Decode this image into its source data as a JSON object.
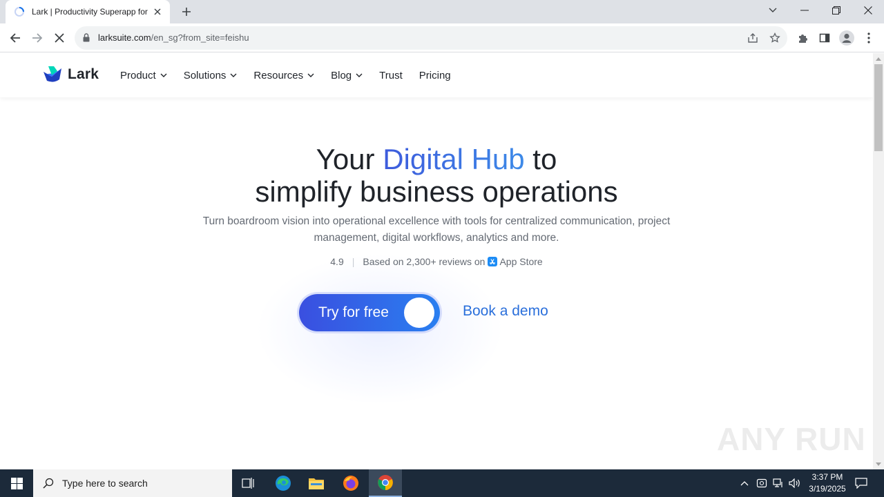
{
  "browser": {
    "tab_title": "Lark | Productivity Superapp for",
    "url_host": "larksuite.com",
    "url_rest": "/en_sg?from_site=feishu"
  },
  "site": {
    "logo_text": "Lark",
    "nav": [
      {
        "label": "Product",
        "has_menu": true
      },
      {
        "label": "Solutions",
        "has_menu": true
      },
      {
        "label": "Resources",
        "has_menu": true
      },
      {
        "label": "Blog",
        "has_menu": true
      },
      {
        "label": "Trust",
        "has_menu": false
      },
      {
        "label": "Pricing",
        "has_menu": false
      }
    ]
  },
  "hero": {
    "title_prefix": "Your ",
    "title_highlight": "Digital Hub",
    "title_suffix": " to",
    "title_line2": "simplify business operations",
    "subtitle": "Turn boardroom vision into operational excellence with tools for centralized communication, project management, digital workflows, analytics and more.",
    "rating_value": "4.9",
    "rating_text": "Based on 2,300+ reviews on",
    "rating_store": "App Store",
    "cta_primary": "Try for free",
    "cta_secondary": "Book a demo"
  },
  "watermark": "ANY RUN",
  "taskbar": {
    "search_placeholder": "Type here to search",
    "time": "3:37 PM",
    "date": "3/19/2025"
  },
  "colors": {
    "brand_blue": "#3370ff",
    "cta_gradient_start": "#3a4fe0",
    "cta_gradient_end": "#2a7ff0",
    "link_blue": "#2a6fdb",
    "taskbar": "#1c2a3a"
  }
}
